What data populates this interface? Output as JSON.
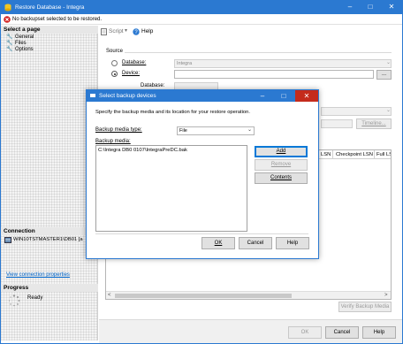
{
  "main_window": {
    "title": "Restore Database - Integra",
    "warning_text": "No backupset selected to be restored.",
    "left_pane": {
      "select_a_page": "Select a page",
      "pages": [
        "General",
        "Files",
        "Options"
      ],
      "connection_header": "Connection",
      "server_name": "WIN10TSTMASTER1\\DB01 [a",
      "view_connection_link": "View connection properties",
      "progress_header": "Progress",
      "progress_status": "Ready"
    },
    "toolbar": {
      "script_label": "Script",
      "help_label": "Help"
    },
    "source": {
      "label": "Source",
      "database_label": "Database:",
      "database_value": "Integra",
      "device_label": "Device:",
      "device_value": "",
      "database_sub_label": "Database:",
      "browse_label": "..."
    },
    "timeline_label": "Timeline...",
    "grid_headers": [
      "LSN",
      "Checkpoint LSN",
      "Full LS"
    ],
    "verify_label": "Verify Backup Media",
    "footer": {
      "ok_label": "OK",
      "cancel_label": "Cancel",
      "help_label": "Help"
    }
  },
  "dialog": {
    "title": "Select backup devices",
    "instruction": "Specify the backup media and its location for your restore operation.",
    "media_type_label": "Backup media type:",
    "media_type_value": "File",
    "media_label": "Backup media:",
    "media_items": [
      "C:\\Integra DB0 0107\\IntegraPreDC.bak"
    ],
    "add_label": "Add",
    "remove_label": "Remove",
    "contents_label": "Contents",
    "ok_label": "OK",
    "cancel_label": "Cancel",
    "help_label": "Help"
  },
  "colors": {
    "accent": "#2b79d1",
    "title_text": "#ffffff",
    "close_red": "#c42b1c",
    "link": "#0066cc",
    "warning": "#d22222"
  },
  "icons": {
    "warning": "error-icon",
    "page": "wrench-icon",
    "script": "script-icon",
    "help": "help-icon",
    "connection": "server-icon",
    "progress": "spinner-icon"
  }
}
